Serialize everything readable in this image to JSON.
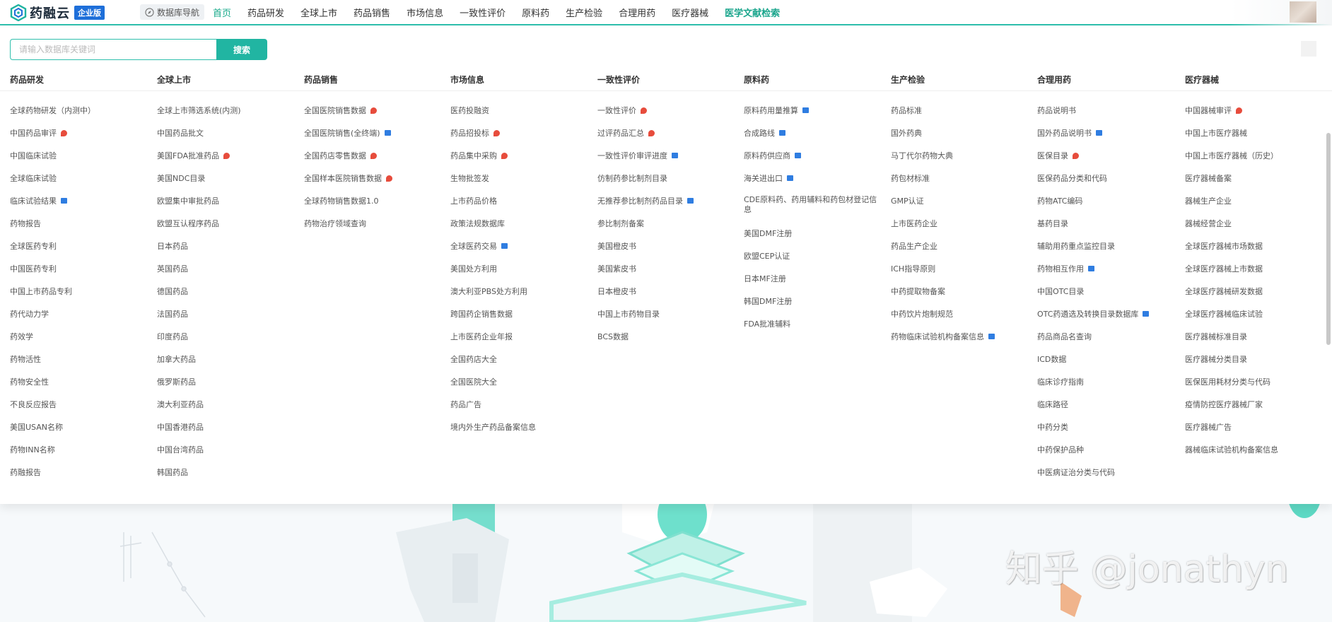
{
  "brand": {
    "name": "药融云",
    "badge": "企业版"
  },
  "db_nav_label": "数据库导航",
  "nav": [
    "首页",
    "药品研发",
    "全球上市",
    "药品销售",
    "市场信息",
    "一致性评价",
    "原料药",
    "生产检验",
    "合理用药",
    "医疗器械",
    "医学文献检索"
  ],
  "search": {
    "placeholder": "请输入数据库关键词",
    "button": "搜索"
  },
  "columns": [
    {
      "title": "药品研发",
      "items": [
        {
          "label": "全球药物研发（内测中）"
        },
        {
          "label": "中国药品审评",
          "badge": "hot"
        },
        {
          "label": "中国临床试验"
        },
        {
          "label": "全球临床试验"
        },
        {
          "label": "临床试验结果",
          "badge": "new"
        },
        {
          "label": "药物报告"
        },
        {
          "label": "全球医药专利"
        },
        {
          "label": "中国医药专利"
        },
        {
          "label": "中国上市药品专利"
        },
        {
          "label": "药代动力学"
        },
        {
          "label": "药效学"
        },
        {
          "label": "药物活性"
        },
        {
          "label": "药物安全性"
        },
        {
          "label": "不良反应报告"
        },
        {
          "label": "美国USAN名称"
        },
        {
          "label": "药物INN名称"
        },
        {
          "label": "药融报告"
        }
      ]
    },
    {
      "title": "全球上市",
      "items": [
        {
          "label": "全球上市筛选系统(内测)"
        },
        {
          "label": "中国药品批文"
        },
        {
          "label": "美国FDA批准药品",
          "badge": "hot"
        },
        {
          "label": "美国NDC目录"
        },
        {
          "label": "欧盟集中审批药品"
        },
        {
          "label": "欧盟互认程序药品"
        },
        {
          "label": "日本药品"
        },
        {
          "label": "英国药品"
        },
        {
          "label": "德国药品"
        },
        {
          "label": "法国药品"
        },
        {
          "label": "印度药品"
        },
        {
          "label": "加拿大药品"
        },
        {
          "label": "俄罗斯药品"
        },
        {
          "label": "澳大利亚药品"
        },
        {
          "label": "中国香港药品"
        },
        {
          "label": "中国台湾药品"
        },
        {
          "label": "韩国药品"
        }
      ]
    },
    {
      "title": "药品销售",
      "items": [
        {
          "label": "全国医院销售数据",
          "badge": "hot"
        },
        {
          "label": "全国医院销售(全终端)",
          "badge": "new"
        },
        {
          "label": "全国药店零售数据",
          "badge": "hot"
        },
        {
          "label": "全国样本医院销售数据",
          "badge": "hot"
        },
        {
          "label": "全球药物销售数据1.0"
        },
        {
          "label": "药物治疗领域查询"
        }
      ]
    },
    {
      "title": "市场信息",
      "items": [
        {
          "label": "医药投融资"
        },
        {
          "label": "药品招投标",
          "badge": "hot"
        },
        {
          "label": "药品集中采购",
          "badge": "hot"
        },
        {
          "label": "生物批签发"
        },
        {
          "label": "上市药品价格"
        },
        {
          "label": "政策法规数据库"
        },
        {
          "label": "全球医药交易",
          "badge": "new"
        },
        {
          "label": "美国处方利用"
        },
        {
          "label": "澳大利亚PBS处方利用"
        },
        {
          "label": "跨国药企销售数据"
        },
        {
          "label": "上市医药企业年报"
        },
        {
          "label": "全国药店大全"
        },
        {
          "label": "全国医院大全"
        },
        {
          "label": "药品广告"
        },
        {
          "label": "境内外生产药品备案信息"
        }
      ]
    },
    {
      "title": "一致性评价",
      "items": [
        {
          "label": "一致性评价",
          "badge": "hot"
        },
        {
          "label": "过评药品汇总",
          "badge": "hot"
        },
        {
          "label": "一致性评价审评进度",
          "badge": "new"
        },
        {
          "label": "仿制药参比制剂目录"
        },
        {
          "label": "无推荐参比制剂药品目录",
          "badge": "new"
        },
        {
          "label": "参比制剂备案"
        },
        {
          "label": "美国橙皮书"
        },
        {
          "label": "美国紫皮书"
        },
        {
          "label": "日本橙皮书"
        },
        {
          "label": "中国上市药物目录"
        },
        {
          "label": "BCS数据"
        }
      ]
    },
    {
      "title": "原料药",
      "items": [
        {
          "label": "原料药用量推算",
          "badge": "new"
        },
        {
          "label": "合成路线",
          "badge": "new"
        },
        {
          "label": "原料药供应商",
          "badge": "new"
        },
        {
          "label": "海关进出口",
          "badge": "new"
        },
        {
          "label": "CDE原料药、药用辅料和药包材登记信息",
          "wrap": true
        },
        {
          "label": "美国DMF注册"
        },
        {
          "label": "欧盟CEP认证"
        },
        {
          "label": "日本MF注册"
        },
        {
          "label": "韩国DMF注册"
        },
        {
          "label": "FDA批准辅料"
        }
      ]
    },
    {
      "title": "生产检验",
      "items": [
        {
          "label": "药品标准"
        },
        {
          "label": "国外药典"
        },
        {
          "label": "马丁代尔药物大典"
        },
        {
          "label": "药包材标准"
        },
        {
          "label": "GMP认证"
        },
        {
          "label": "上市医药企业"
        },
        {
          "label": "药品生产企业"
        },
        {
          "label": "ICH指导原则"
        },
        {
          "label": "中药提取物备案"
        },
        {
          "label": "中药饮片炮制规范"
        },
        {
          "label": "药物临床试验机构备案信息",
          "badge": "new"
        }
      ]
    },
    {
      "title": "合理用药",
      "items": [
        {
          "label": "药品说明书"
        },
        {
          "label": "国外药品说明书",
          "badge": "new"
        },
        {
          "label": "医保目录",
          "badge": "hot"
        },
        {
          "label": "医保药品分类和代码"
        },
        {
          "label": "药物ATC编码"
        },
        {
          "label": "基药目录"
        },
        {
          "label": "辅助用药重点监控目录"
        },
        {
          "label": "药物相互作用",
          "badge": "new"
        },
        {
          "label": "中国OTC目录"
        },
        {
          "label": "OTC药遴选及转换目录数据库",
          "badge": "new"
        },
        {
          "label": "药品商品名查询"
        },
        {
          "label": "ICD数据"
        },
        {
          "label": "临床诊疗指南"
        },
        {
          "label": "临床路径"
        },
        {
          "label": "中药分类"
        },
        {
          "label": "中药保护品种"
        },
        {
          "label": "中医病证治分类与代码"
        }
      ]
    },
    {
      "title": "医疗器械",
      "items": [
        {
          "label": "中国器械审评",
          "badge": "hot"
        },
        {
          "label": "中国上市医疗器械"
        },
        {
          "label": "中国上市医疗器械（历史）"
        },
        {
          "label": "医疗器械备案"
        },
        {
          "label": "器械生产企业"
        },
        {
          "label": "器械经营企业"
        },
        {
          "label": "全球医疗器械市场数据"
        },
        {
          "label": "全球医疗器械上市数据"
        },
        {
          "label": "全球医疗器械研发数据"
        },
        {
          "label": "全球医疗器械临床试验"
        },
        {
          "label": "医疗器械标准目录"
        },
        {
          "label": "医疗器械分类目录"
        },
        {
          "label": "医保医用耗材分类与代码"
        },
        {
          "label": "疫情防控医疗器械厂家"
        },
        {
          "label": "医疗器械广告"
        },
        {
          "label": "器械临床试验机构备案信息"
        }
      ]
    }
  ],
  "watermark": "知乎 @jonathyn",
  "colors": {
    "accent": "#21b5a2",
    "brand_badge": "#1e6fd9",
    "hot": "#e74c3c",
    "new": "#2f7de1"
  }
}
